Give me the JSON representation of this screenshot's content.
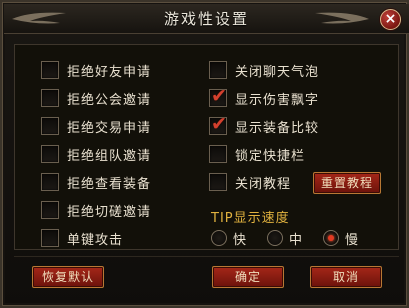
{
  "window": {
    "title": "游戏性设置",
    "close_glyph": "×"
  },
  "left_options": [
    {
      "label": "拒绝好友申请",
      "checked": false
    },
    {
      "label": "拒绝公会邀请",
      "checked": false
    },
    {
      "label": "拒绝交易申请",
      "checked": false
    },
    {
      "label": "拒绝组队邀请",
      "checked": false
    },
    {
      "label": "拒绝查看装备",
      "checked": false
    },
    {
      "label": "拒绝切磋邀请",
      "checked": false
    },
    {
      "label": "单键攻击",
      "checked": false
    }
  ],
  "right_options": [
    {
      "label": "关闭聊天气泡",
      "checked": false
    },
    {
      "label": "显示伤害飘字",
      "checked": true
    },
    {
      "label": "显示装备比较",
      "checked": true
    },
    {
      "label": "锁定快捷栏",
      "checked": false
    },
    {
      "label": "关闭教程",
      "checked": false
    }
  ],
  "tick_glyph": "✔",
  "reset_tutorial_label": "重置教程",
  "tip_speed": {
    "title": "TIP显示速度",
    "options": [
      {
        "label": "快",
        "selected": false
      },
      {
        "label": "中",
        "selected": false
      },
      {
        "label": "慢",
        "selected": true
      }
    ]
  },
  "footer": {
    "restore_label": "恢复默认",
    "ok_label": "确定",
    "cancel_label": "取消"
  },
  "colors": {
    "accent_red": "#a52718",
    "tip_title": "#e1b23f",
    "tick": "#d2402e"
  }
}
